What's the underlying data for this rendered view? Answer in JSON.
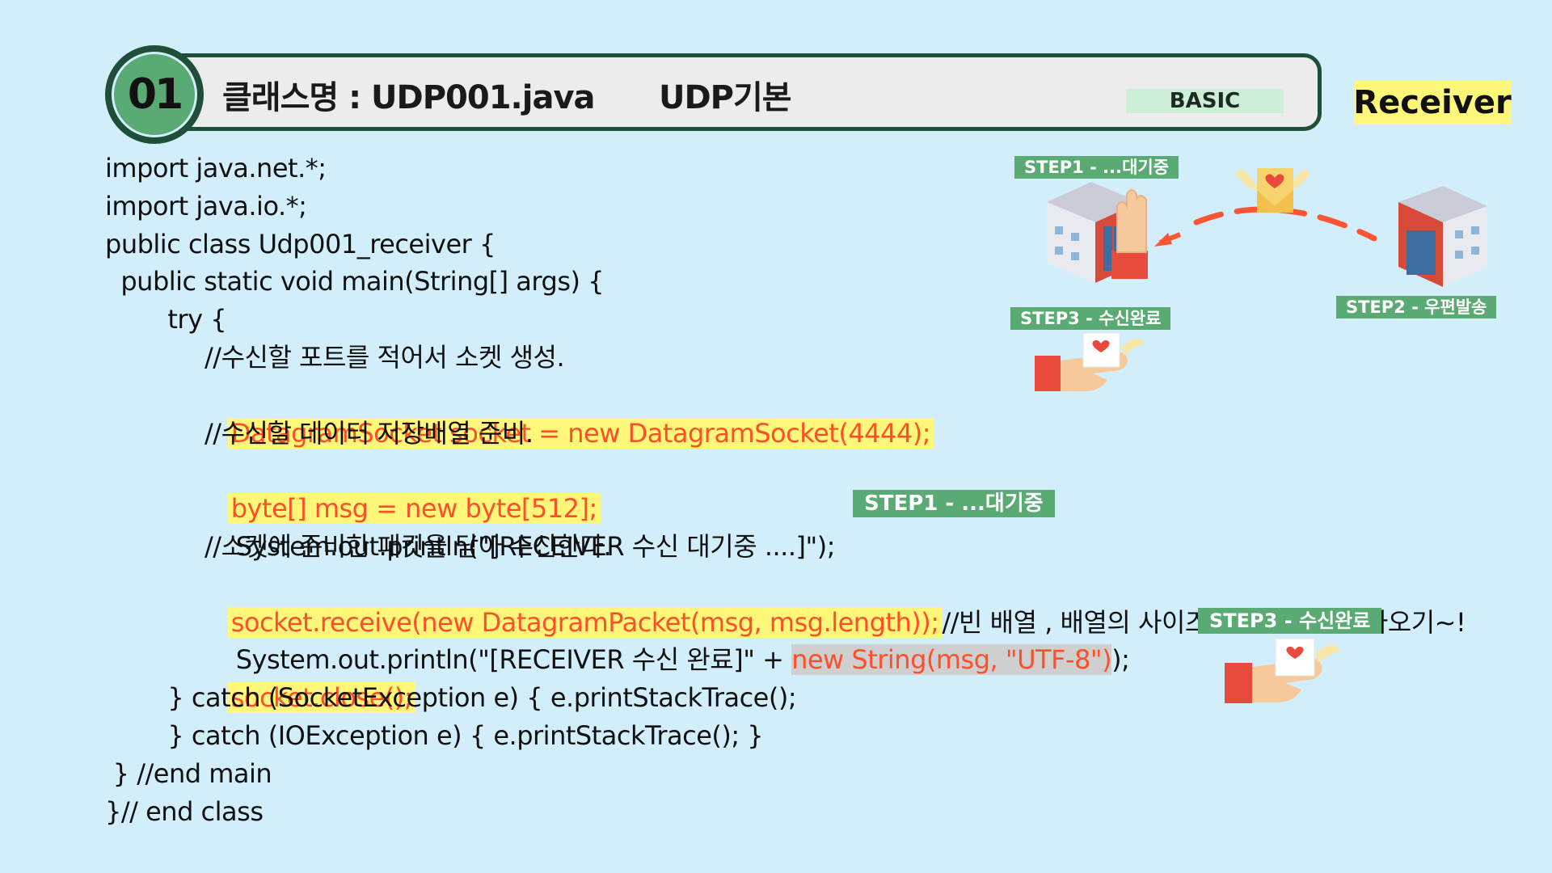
{
  "header": {
    "badge_number": "01",
    "class_name": "클래스명 : UDP001.java",
    "topic": "UDP기본",
    "level": "BASIC"
  },
  "role": "Receiver",
  "code_lines": {
    "l1": "import java.net.*;",
    "l2": "import java.io.*;",
    "l3": "public class Udp001_receiver {",
    "l4": "  public static void main(String[] args) {",
    "l5": "        try {",
    "l6": "//수신할 포트를 적어서 소켓 생성.",
    "l7": "DatagramSocket socket = new DatagramSocket(4444);",
    "l8": "//수신할 데이터 저장배열 준비.",
    "l9": "byte[] msg = new byte[512];",
    "l10": "System.out.println(\"[RECEIVER 수신 대기중 ....]\");",
    "l11": "//소켓에 준비한 패킷을 담아 수신한다.",
    "l12": "socket.receive(new DatagramPacket(msg, msg.length));",
    "l12_comment": "//빈 배열 , 배열의 사이즈만큼 데이터 받아오기~!",
    "l13_a": "System.out.println(\"[RECEIVER 수신 완료]\" + ",
    "l13_b": "new String(msg, \"UTF-8\")",
    "l13_c": ");",
    "l14": "socket.close();",
    "l15": "        } catch (SocketException e) { e.printStackTrace();",
    "l16": "        } catch (IOException e) { e.printStackTrace(); }",
    "l17": " } //end main",
    "l18": "}// end class"
  },
  "steps": {
    "step1": "STEP1 - ...대기중",
    "step2": "STEP2 - 우편발송",
    "step3": "STEP3 - 수신완료"
  },
  "colors": {
    "background": "#d3eefb",
    "header_border": "#1f4f38",
    "badge_fill": "#5aaa74",
    "highlight_bg": "#fff77a",
    "highlight_text": "#ff4f2a",
    "step_tag": "#5aaa74"
  },
  "icons": [
    "post-office-building-icon",
    "raised-hand-icon",
    "winged-envelope-icon",
    "dashed-arrow-icon",
    "hand-holding-envelope-icon"
  ]
}
